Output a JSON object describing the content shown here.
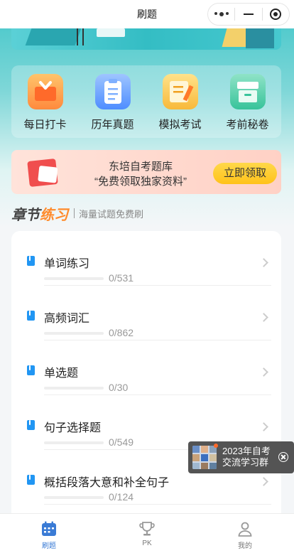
{
  "titlebar": {
    "title": "刷题"
  },
  "quick": [
    {
      "label": "每日打卡",
      "icon": "calendar-check-icon"
    },
    {
      "label": "历年真题",
      "icon": "clipboard-icon"
    },
    {
      "label": "模拟考试",
      "icon": "exam-pencil-icon"
    },
    {
      "label": "考前秘卷",
      "icon": "secret-paper-icon"
    }
  ],
  "promo": {
    "line1": "东培自考题库",
    "line2": "“免费领取独家资料”",
    "button": "立即领取"
  },
  "section": {
    "title_a": "章节",
    "title_b": "练习",
    "subtitle": "海量试题免费刷"
  },
  "chapters": [
    {
      "name": "单词练习",
      "count": "0/531"
    },
    {
      "name": "高频词汇",
      "count": "0/862"
    },
    {
      "name": "单选题",
      "count": "0/30"
    },
    {
      "name": "句子选择题",
      "count": "0/549"
    },
    {
      "name": "概括段落大意和补全句子",
      "count": "0/124"
    }
  ],
  "float": {
    "line1": "2023年自考",
    "line2": "交流学习群"
  },
  "tabs": [
    {
      "label": "刷题",
      "active": true
    },
    {
      "label": "PK",
      "active": false
    },
    {
      "label": "我的",
      "active": false
    }
  ],
  "colors": {
    "accent": "#3fc5c8",
    "tab_active": "#3a7bd5",
    "bookmark": "#2196f3",
    "highlight": "#ff8a2a"
  }
}
